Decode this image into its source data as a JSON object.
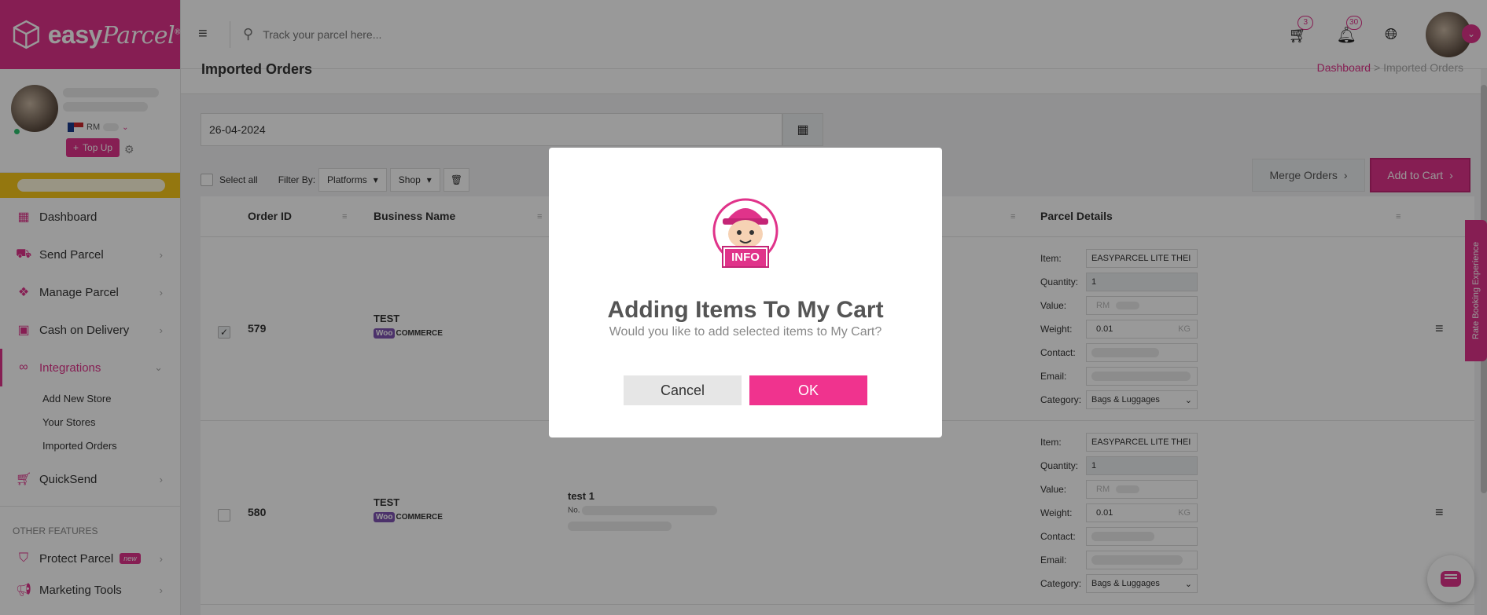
{
  "brand": {
    "name": "easy",
    "name_italic": "Parcel",
    "mark": "®"
  },
  "header": {
    "search_placeholder": "Track your parcel here...",
    "cart_count": "3",
    "notif_count": "30"
  },
  "profile": {
    "currency": "RM",
    "topup_label": "Top Up"
  },
  "sidebar": {
    "items": [
      {
        "label": "Dashboard"
      },
      {
        "label": "Send Parcel"
      },
      {
        "label": "Manage Parcel"
      },
      {
        "label": "Cash on Delivery"
      },
      {
        "label": "Integrations"
      },
      {
        "label": "QuickSend"
      }
    ],
    "sub_items": [
      {
        "label": "Add New Store"
      },
      {
        "label": "Your Stores"
      },
      {
        "label": "Imported Orders"
      }
    ],
    "other_label": "OTHER FEATURES",
    "other_items": [
      {
        "label": "Protect Parcel",
        "badge": "new"
      },
      {
        "label": "Marketing Tools"
      }
    ]
  },
  "page": {
    "title": "Imported Orders",
    "breadcrumb": [
      "Dashboard",
      ">",
      "Imported Orders"
    ],
    "date": "26-04-2024",
    "select_all": "Select all",
    "filter_by": "Filter By:",
    "filter_platforms": "Platforms",
    "filter_shop": "Shop",
    "merge_label": "Merge Orders",
    "add_cart_label": "Add to Cart"
  },
  "table": {
    "headers": {
      "order_id": "Order ID",
      "business": "Business Name",
      "parcel": "Parcel Details"
    },
    "pd_labels": {
      "item": "Item:",
      "quantity": "Quantity:",
      "value": "Value:",
      "weight": "Weight:",
      "contact": "Contact:",
      "email": "Email:",
      "category": "Category:"
    },
    "rows": [
      {
        "id": "579",
        "business": "TEST",
        "platform_w": "Woo",
        "platform_rest": "COMMERCE",
        "receiver": "",
        "item": "EASYPARCEL LITE THEI",
        "quantity": "1",
        "value_unit": "RM",
        "weight": "0.01",
        "weight_unit": "KG",
        "category": "Bags & Luggages",
        "checked": true
      },
      {
        "id": "580",
        "business": "TEST",
        "platform_w": "Woo",
        "platform_rest": "COMMERCE",
        "receiver": "test 1",
        "receiver_no": "No.",
        "item": "EASYPARCEL LITE THEI",
        "quantity": "1",
        "value_unit": "RM",
        "weight": "0.01",
        "weight_unit": "KG",
        "category": "Bags & Luggages",
        "checked": false
      }
    ]
  },
  "rate_tab": "Rate Booking Experience",
  "modal": {
    "badge": "INFO",
    "title": "Adding Items To My Cart",
    "text": "Would you like to add selected items to My Cart?",
    "cancel": "Cancel",
    "ok": "OK"
  },
  "colors": {
    "brand": "#e0338a",
    "announce": "#f7c719"
  }
}
